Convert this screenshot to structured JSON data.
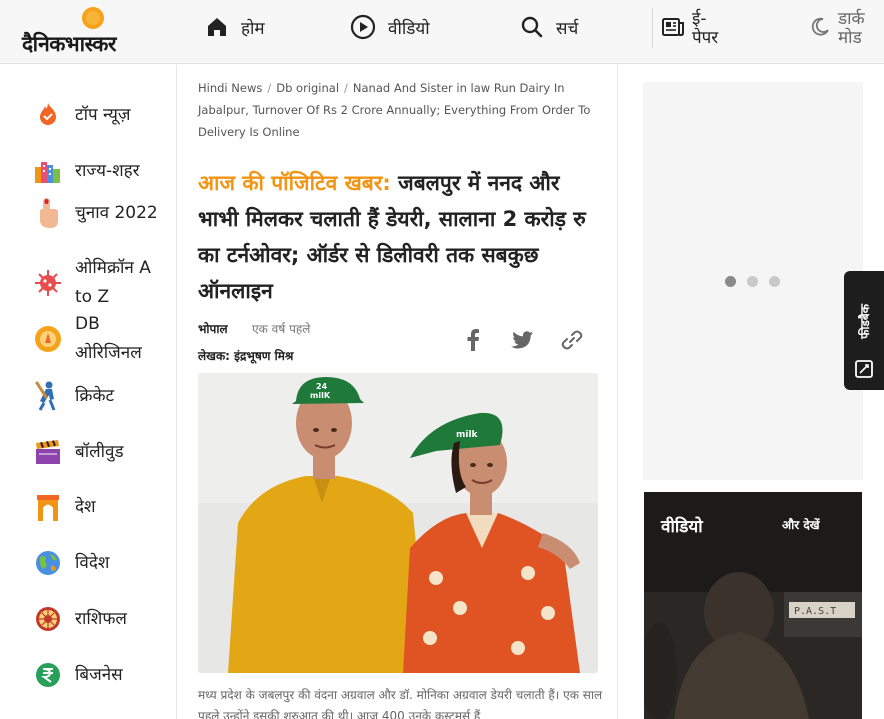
{
  "header": {
    "brand": "दैनिकभास्कर",
    "nav": {
      "home": "होम",
      "video": "वीडियो",
      "search": "सर्च",
      "epaper": "ई-पेपर",
      "dark_mode": "डार्क मोड"
    }
  },
  "sidebar": {
    "items": [
      {
        "label": "टॉप न्यूज़",
        "icon": "top-news-fire-icon"
      },
      {
        "label": "राज्य-शहर",
        "icon": "city-buildings-icon"
      },
      {
        "label": "चुनाव 2022",
        "icon": "election-finger-icon"
      },
      {
        "label": "ओमिक्रॉन A to Z",
        "icon": "virus-icon"
      },
      {
        "label": "DB ओरिजिनल",
        "icon": "db-original-sun-icon"
      },
      {
        "label": "क्रिकेट",
        "icon": "cricket-player-icon"
      },
      {
        "label": "बॉलीवुड",
        "icon": "clapperboard-icon"
      },
      {
        "label": "देश",
        "icon": "india-gate-icon"
      },
      {
        "label": "विदेश",
        "icon": "globe-icon"
      },
      {
        "label": "राशिफल",
        "icon": "zodiac-wheel-icon"
      },
      {
        "label": "बिजनेस",
        "icon": "rupee-icon"
      }
    ]
  },
  "article": {
    "breadcrumb": {
      "items": [
        "Hindi News",
        "Db original"
      ],
      "current": "Nanad And Sister in law Run Dairy In Jabalpur, Turnover Of Rs 2 Crore Annually; Everything From Order To Delivery Is Online"
    },
    "kicker": "आज की पॉजिटिव खबर:",
    "headline": "जबलपुर में ननद और भाभी मिलकर चलाती हैं डेयरी, सालाना 2 करोड़ रु का टर्नओवर; ऑर्डर से डिलीवरी तक सबकुछ ऑनलाइन",
    "city": "भोपाल",
    "time": "एक वर्ष पहले",
    "author": "लेखक: इंद्रभूषण मिश्र",
    "cap_text_left": "24",
    "cap_text_left_2": "milK",
    "cap_text_right": "milk",
    "caption": "मध्य प्रदेश के जबलपुर की वंदना अग्रवाल और डॉ. मोनिका अग्रवाल डेयरी चलाती हैं। एक साल पहले उन्होंने इसकी शुरुआत की थी। आज 400 उनके कस्टमर्स हैं"
  },
  "right": {
    "carousel": {
      "dots": 3,
      "active": 0
    },
    "video": {
      "title": "वीडियो",
      "more": "और देखें",
      "sign": "P.A.S.T"
    },
    "feedback": "फीडबैक"
  },
  "colors": {
    "kicker": "#f29414",
    "logo_sun": "#f5a31a",
    "feedback_bg": "#1d1d1d"
  }
}
